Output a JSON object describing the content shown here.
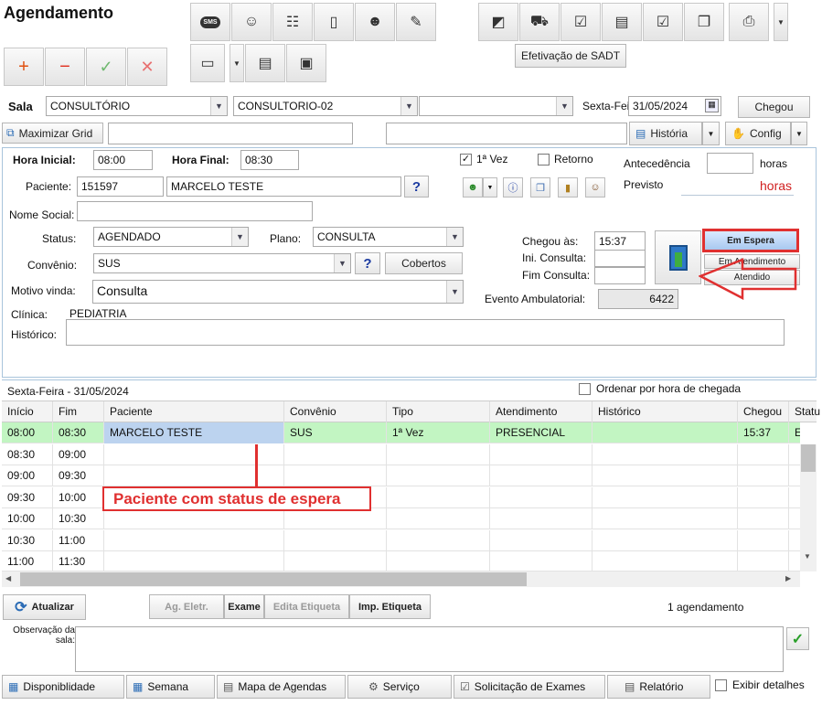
{
  "header": {
    "title": "Agendamento"
  },
  "toolbar": {
    "sms_icon_text": "SMS",
    "sadt_label": "Efetivação de SADT"
  },
  "filters": {
    "sala_label": "Sala",
    "sala_value": "CONSULTÓRIO",
    "sub_sala_value": "CONSULTORIO-02",
    "extra_value": "",
    "day_label": "Sexta-Fei",
    "date_value": "31/05/2024",
    "chegou_btn": "Chegou"
  },
  "bar2": {
    "maximizar_label": "Maximizar Grid",
    "historia_label": "História",
    "config_label": "Config"
  },
  "form": {
    "hora_inicial_label": "Hora Inicial:",
    "hora_inicial_value": "08:00",
    "hora_final_label": "Hora Final:",
    "hora_final_value": "08:30",
    "primeira_vez_label": "1ª Vez",
    "retorno_label": "Retorno",
    "antecedencia_label": "Antecedência",
    "horas_label": "horas",
    "previsto_label": "Previsto",
    "previsto_value": "horas",
    "paciente_label": "Paciente:",
    "paciente_id": "151597",
    "paciente_nome": "MARCELO TESTE",
    "help_symbol": "?",
    "nome_social_label": "Nome Social:",
    "status_label": "Status:",
    "status_value": "AGENDADO",
    "plano_label": "Plano:",
    "plano_value": "CONSULTA",
    "convenio_label": "Convênio:",
    "convenio_value": "SUS",
    "cobertos_label": "Cobertos",
    "motivo_label": "Motivo vinda:",
    "motivo_value": "Consulta",
    "clinica_label": "Clínica:",
    "clinica_value": "PEDIATRIA",
    "historico_label": "Histórico:",
    "chegou_as_label": "Chegou às:",
    "chegou_as_value": "15:37",
    "ini_consulta_label": "Ini. Consulta:",
    "fim_consulta_label": "Fim Consulta:",
    "evento_label": "Evento Ambulatorial:",
    "evento_value": "6422",
    "em_espera_label": "Em Espera",
    "em_atendimento_label": "Em Atendimento",
    "atendido_label": "Atendido"
  },
  "schedule": {
    "date_heading": "Sexta-Feira - 31/05/2024",
    "ordenar_label": "Ordenar por hora de chegada",
    "columns": [
      "Início",
      "Fim",
      "Paciente",
      "Convênio",
      "Tipo",
      "Atendimento",
      "Histórico",
      "Chegou",
      "Statu"
    ],
    "rows": [
      [
        "08:00",
        "08:30",
        "MARCELO TESTE",
        "SUS",
        "1ª Vez",
        "PRESENCIAL",
        "",
        "15:37",
        "E"
      ],
      [
        "08:30",
        "09:00",
        "",
        "",
        "",
        "",
        "",
        "",
        ""
      ],
      [
        "09:00",
        "09:30",
        "",
        "",
        "",
        "",
        "",
        "",
        ""
      ],
      [
        "09:30",
        "10:00",
        "",
        "",
        "",
        "",
        "",
        "",
        ""
      ],
      [
        "10:00",
        "10:30",
        "",
        "",
        "",
        "",
        "",
        "",
        ""
      ],
      [
        "10:30",
        "11:00",
        "",
        "",
        "",
        "",
        "",
        "",
        ""
      ],
      [
        "11:00",
        "11:30",
        "",
        "",
        "",
        "",
        "",
        "",
        ""
      ]
    ],
    "annotation": "Paciente com status de espera"
  },
  "footer": {
    "atualizar_label": "Atualizar",
    "ag_eletr_label": "Ag. Eletr.",
    "exame_label": "Exame",
    "edita_etiqueta_label": "Edita Etiqueta",
    "imp_etiqueta_label": "Imp. Etiqueta",
    "count_text": "1 agendamento",
    "observacao_label": "Observação da sala:",
    "disponibilidade_label": "Disponiblidade",
    "semana_label": "Semana",
    "mapa_label": "Mapa de Agendas",
    "servico_label": "Serviço",
    "solicitacao_label": "Solicitação de Exames",
    "relatorio_label": "Relatório",
    "exibir_label": "Exibir detalhes"
  },
  "colors": {
    "accent_red": "#e03030",
    "selected_row": "#c2f5c2",
    "patient_cell": "#bcd3ef"
  }
}
